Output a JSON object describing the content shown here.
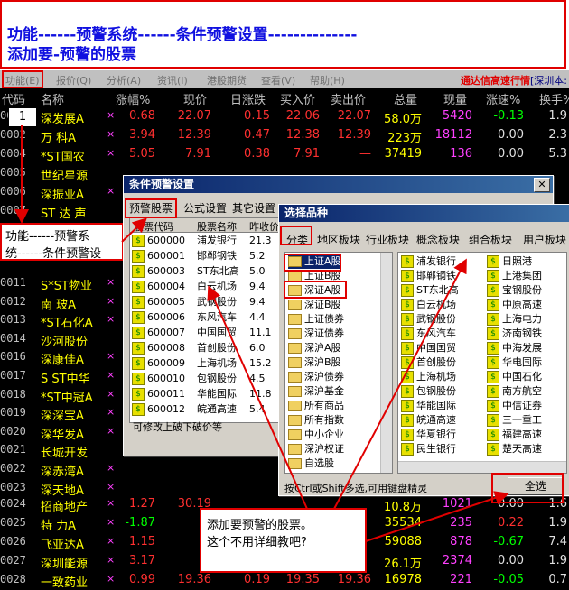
{
  "annotation_top": {
    "line1": "功能------预警系统------条件预警设置--------------",
    "line2": "添加要-预警的股票"
  },
  "menubar": {
    "items": [
      "功能(E)",
      "报价(Q)",
      "分析(A)",
      "资讯(I)",
      "港股期货",
      "查看(V)",
      "帮助(H)"
    ],
    "right_text": "通达信高速行情",
    "right_tail": "[深圳本:"
  },
  "grid": {
    "headers": [
      "代码",
      "名称",
      "涨幅%",
      "现价",
      "日涨跌",
      "买入价",
      "卖出价",
      "总量",
      "现量",
      "涨速%",
      "换手%"
    ],
    "rows_top": [
      {
        "code": "0001",
        "name": "深发展A",
        "mark": "×",
        "chg": "0.68",
        "price": "22.07",
        "diff": "0.15",
        "buy": "22.06",
        "sell": "22.07",
        "vol": "58.0万",
        "cur": "5420",
        "speed": "-0.13",
        "turn": "1.9"
      },
      {
        "code": "0002",
        "name": "万 科A",
        "mark": "×",
        "chg": "3.94",
        "price": "12.39",
        "diff": "0.47",
        "buy": "12.38",
        "sell": "12.39",
        "vol": "223万",
        "cur": "18112",
        "speed": "0.00",
        "turn": "2.3"
      },
      {
        "code": "0004",
        "name": "*ST国农",
        "mark": "×",
        "chg": "5.05",
        "price": "7.91",
        "diff": "0.38",
        "buy": "7.91",
        "sell": "—",
        "vol": "37419",
        "cur": "136",
        "speed": "0.00",
        "turn": "5.3"
      },
      {
        "code": "0005",
        "name": "世纪星源",
        "mark": "",
        "chg": "",
        "price": "",
        "diff": "",
        "buy": "",
        "sell": "",
        "vol": "",
        "cur": "",
        "speed": "",
        "turn": ""
      },
      {
        "code": "0006",
        "name": "深振业A",
        "mark": "×",
        "chg": "",
        "price": "",
        "diff": "",
        "buy": "",
        "sell": "",
        "vol": "",
        "cur": "",
        "speed": "",
        "turn": ""
      },
      {
        "code": "0007",
        "name": "ST 达 声",
        "mark": "",
        "chg": "",
        "price": "",
        "diff": "",
        "buy": "",
        "sell": "",
        "vol": "",
        "cur": "",
        "speed": "",
        "turn": ""
      }
    ],
    "rows_bottom": [
      {
        "code": "0011",
        "name": "S*ST物业",
        "mark": "×"
      },
      {
        "code": "0012",
        "name": "南 玻A",
        "mark": "×"
      },
      {
        "code": "0013",
        "name": "*ST石化A",
        "mark": "×"
      },
      {
        "code": "0014",
        "name": "沙河股份",
        "mark": ""
      },
      {
        "code": "0016",
        "name": "深康佳A",
        "mark": "×"
      },
      {
        "code": "0017",
        "name": "S ST中华",
        "mark": "×"
      },
      {
        "code": "0018",
        "name": "*ST中冠A",
        "mark": "×"
      },
      {
        "code": "0019",
        "name": "深深宝A",
        "mark": "×"
      },
      {
        "code": "0020",
        "name": "深华发A",
        "mark": "×"
      },
      {
        "code": "0021",
        "name": "长城开发",
        "mark": ""
      },
      {
        "code": "0022",
        "name": "深赤湾A",
        "mark": "×"
      },
      {
        "code": "0023",
        "name": "深天地A",
        "mark": "×"
      }
    ],
    "rows_tail": [
      {
        "code": "0024",
        "name": "招商地产",
        "mark": "×",
        "chg": "1.27",
        "price": "30.19",
        "vol": "10.8万",
        "cur": "1021",
        "speed": "0.00",
        "turn": "1.6"
      },
      {
        "code": "0025",
        "name": "特 力A",
        "mark": "×",
        "chg": "-1.87",
        "price": "",
        "vol": "35534",
        "cur": "235",
        "speed": "0.22",
        "turn": "1.9"
      },
      {
        "code": "0026",
        "name": "飞亚达A",
        "mark": "×",
        "chg": "1.15",
        "price": "",
        "vol": "59088",
        "cur": "878",
        "speed": "-0.67",
        "turn": "7.4"
      },
      {
        "code": "0027",
        "name": "深圳能源",
        "mark": "×",
        "chg": "3.17",
        "price": "",
        "vol": "26.1万",
        "cur": "2374",
        "speed": "0.00",
        "turn": "1.9"
      },
      {
        "code": "0028",
        "name": "一致药业",
        "mark": "×",
        "chg": "0.99",
        "price": "19.36",
        "diff": "0.19",
        "buy": "19.35",
        "sell": "19.36",
        "vol": "16978",
        "cur": "221",
        "speed": "-0.05",
        "turn": "0.7"
      }
    ]
  },
  "badge_1": "1",
  "left_note": {
    "line1": "功能------预警系",
    "line2": "统------条件预警设"
  },
  "cond_dialog": {
    "title": "条件预警设置",
    "tabs": [
      "预警股票",
      "公式设置",
      "其它设置"
    ],
    "columns": [
      "股票代码",
      "股票名称",
      "昨收价"
    ],
    "rows": [
      {
        "code": "600000",
        "name": "浦发银行",
        "close": "21.3"
      },
      {
        "code": "600001",
        "name": "邯郸钢铁",
        "close": "5.2"
      },
      {
        "code": "600003",
        "name": "ST东北高",
        "close": "5.0"
      },
      {
        "code": "600004",
        "name": "白云机场",
        "close": "9.4"
      },
      {
        "code": "600005",
        "name": "武钢股份",
        "close": "9.4"
      },
      {
        "code": "600006",
        "name": "东风汽车",
        "close": "4.4"
      },
      {
        "code": "600007",
        "name": "中国国贸",
        "close": "11.1"
      },
      {
        "code": "600008",
        "name": "首创股份",
        "close": "6.0"
      },
      {
        "code": "600009",
        "name": "上海机场",
        "close": "15.2"
      },
      {
        "code": "600010",
        "name": "包钢股份",
        "close": "4.5"
      },
      {
        "code": "600011",
        "name": "华能国际",
        "close": "11.8"
      },
      {
        "code": "600012",
        "name": "皖通高速",
        "close": "5.4"
      }
    ],
    "footer": "可修改上破下破价等"
  },
  "select_dialog": {
    "title": "选择品种",
    "tabs": [
      "分类",
      "地区板块",
      "行业板块",
      "概念板块",
      "组合板块",
      "用户板块"
    ],
    "categories": [
      "上证A股",
      "上证B股",
      "深证A股",
      "深证B股",
      "上证债券",
      "深证债券",
      "深沪A股",
      "深沪B股",
      "深沪债券",
      "深沪基金",
      "所有商品",
      "所有指数",
      "中小企业",
      "深沪权证",
      "自选股"
    ],
    "stocks_col1": [
      "浦发银行",
      "邯郸钢铁",
      "ST东北高",
      "白云机场",
      "武钢股份",
      "东风汽车",
      "中国国贸",
      "首创股份",
      "上海机场",
      "包钢股份",
      "华能国际",
      "皖通高速",
      "华夏银行",
      "民生银行"
    ],
    "stocks_col2": [
      "日照港",
      "上港集团",
      "宝钢股份",
      "中原高速",
      "上海电力",
      "济南钢铁",
      "中海发展",
      "华电国际",
      "中国石化",
      "南方航空",
      "中信证券",
      "三一重工",
      "福建高速",
      "楚天高速"
    ],
    "hint": "按Ctrl或Shift多选,可用键盘精灵",
    "select_all": "全选"
  },
  "bottom_note": {
    "line1": "添加要预警的股票。",
    "line2": "这个不用详细教吧?"
  }
}
